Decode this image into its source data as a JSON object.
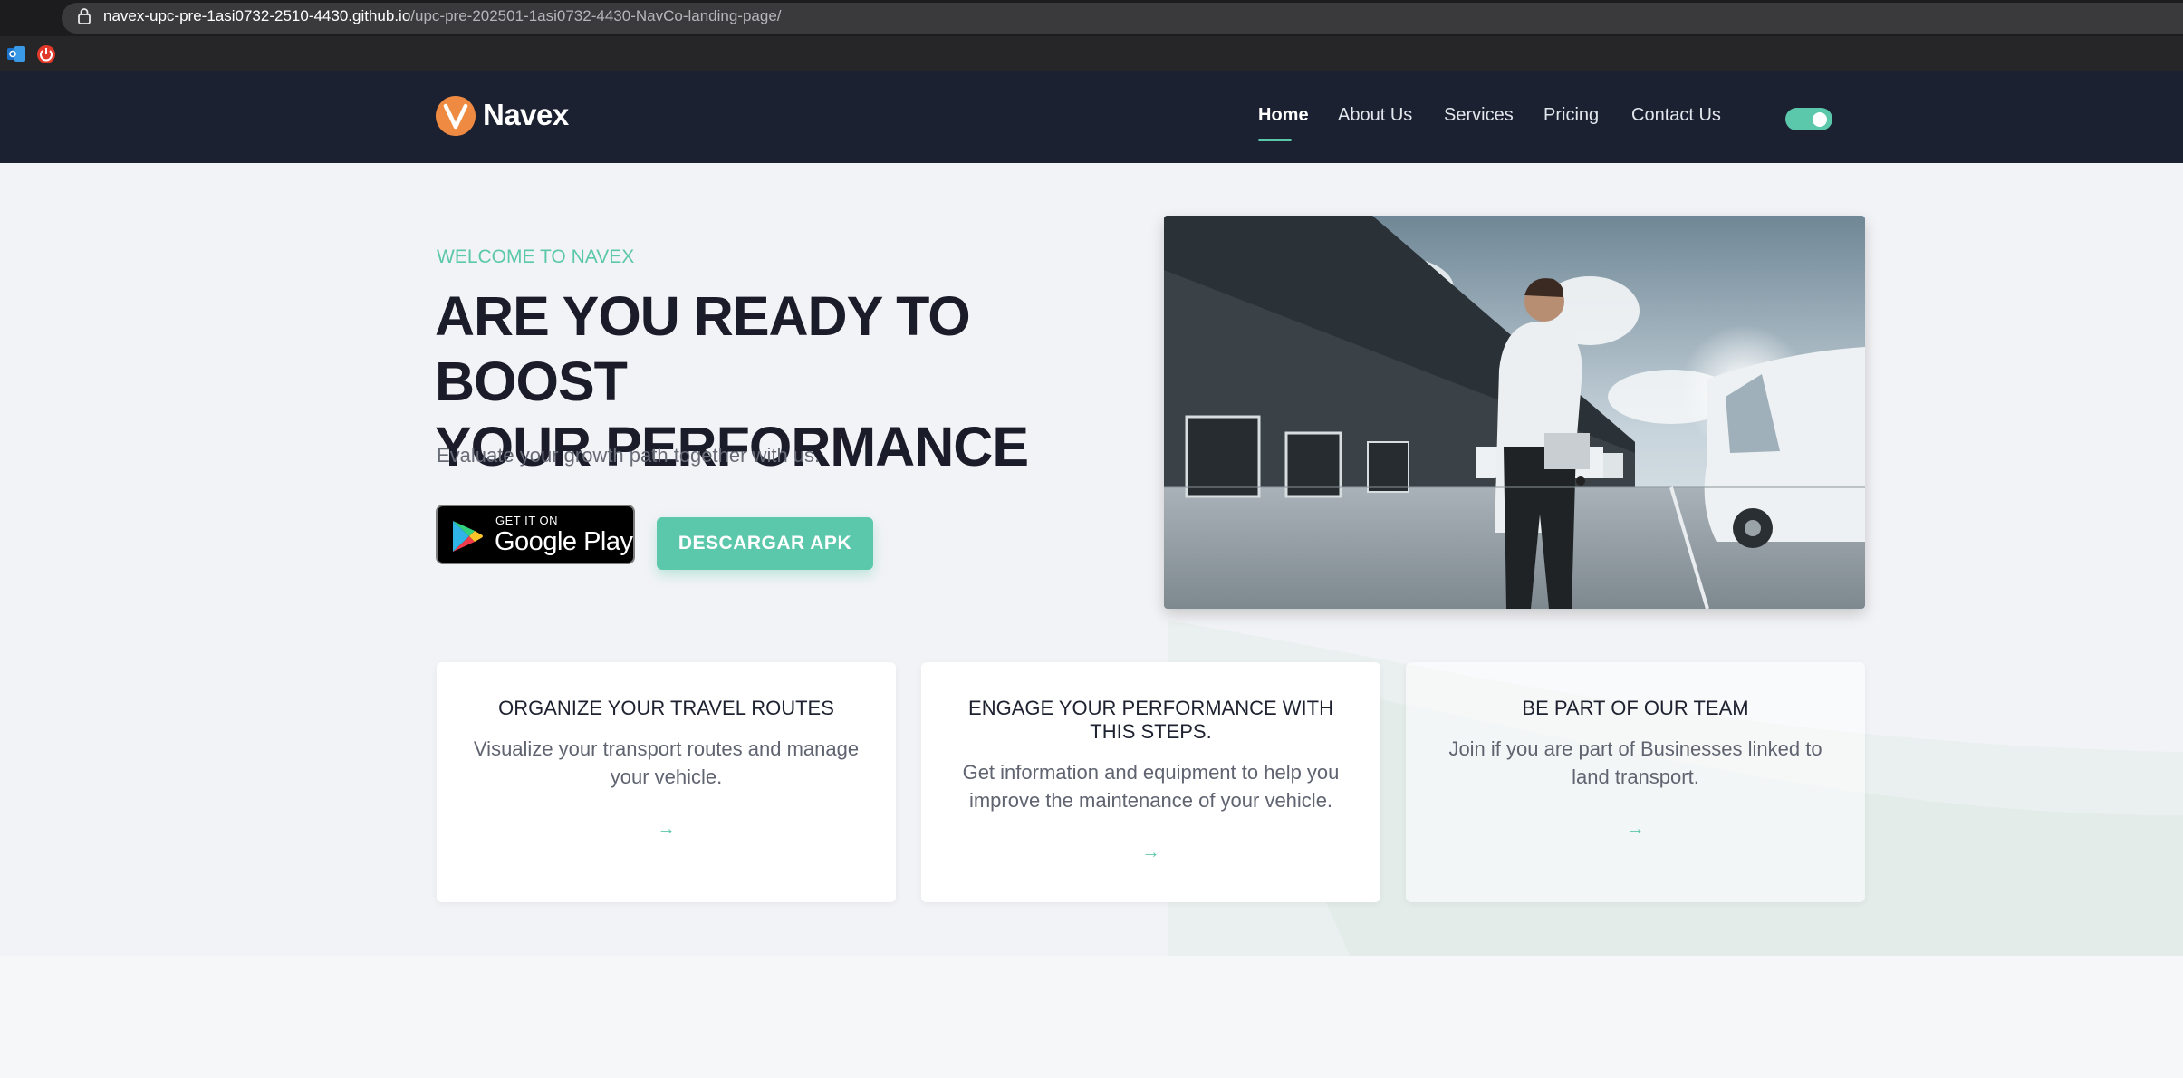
{
  "browser": {
    "url_host": "navex-upc-pre-1asi0732-2510-4430.github.io",
    "url_path": "/upc-pre-202501-1asi0732-4430-NavCo-landing-page/"
  },
  "brand": {
    "name": "Navex",
    "accent": "#5cc8ab",
    "logo_color": "#ee8a42",
    "nav_bg": "#1b2131"
  },
  "nav": {
    "items": [
      {
        "label": "Home",
        "active": true
      },
      {
        "label": "About Us"
      },
      {
        "label": "Services"
      },
      {
        "label": "Pricing"
      },
      {
        "label": "Contact Us"
      }
    ],
    "theme_toggle_on": true
  },
  "hero": {
    "eyebrow": "WELCOME TO NAVEX",
    "headline_line1": "ARE YOU READY TO BOOST",
    "headline_line2": "YOUR PERFORMANCE",
    "subtitle": "Evaluate your growth path together with us.",
    "google_play_small": "GET IT ON",
    "google_play_big": "Google Play",
    "apk_button": "DESCARGAR APK"
  },
  "cards": [
    {
      "title": "ORGANIZE YOUR TRAVEL ROUTES",
      "text": "Visualize your transport routes and manage your vehicle.",
      "arrow": "→"
    },
    {
      "title": "ENGAGE YOUR PERFORMANCE WITH THIS STEPS.",
      "text": "Get information and equipment to help you improve the maintenance of your vehicle.",
      "arrow": "→"
    },
    {
      "title": "BE PART OF OUR TEAM",
      "text": "Join if you are part of Businesses linked to land transport.",
      "arrow": "→"
    }
  ]
}
